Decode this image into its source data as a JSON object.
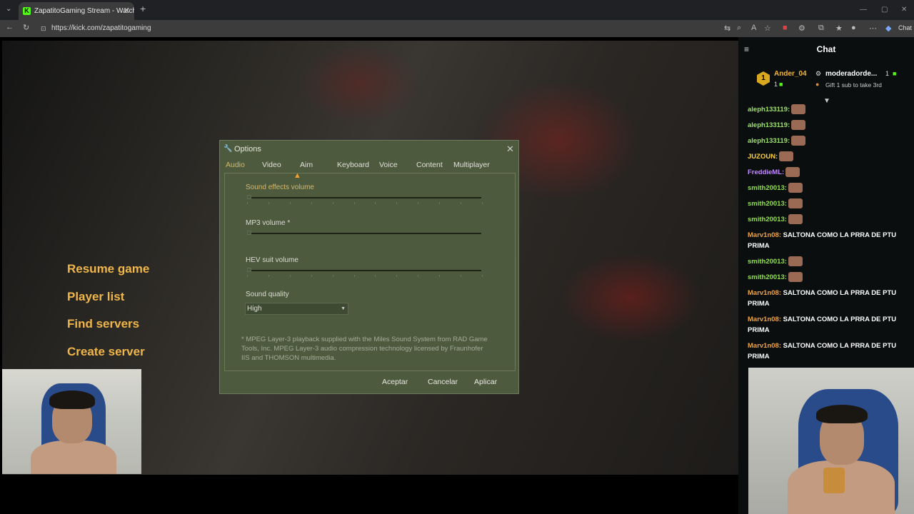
{
  "browser": {
    "tab_title": "ZapatitoGaming Stream - Watch L",
    "favicon_letter": "K",
    "url": "https://kick.com/zapatitogaming",
    "chat_button": "Chat"
  },
  "game_menu": {
    "items": [
      "Resume game",
      "Player list",
      "Find servers",
      "Create server"
    ]
  },
  "dialog": {
    "title": "Options",
    "tabs": [
      "Audio",
      "Video",
      "Aim",
      "Keyboard",
      "Voice",
      "Content",
      "Multiplayer"
    ],
    "active_tab": "Audio",
    "sliders": [
      {
        "label": "Sound effects volume",
        "value": 0
      },
      {
        "label": "MP3 volume *",
        "value": 0
      },
      {
        "label": "HEV suit volume",
        "value": 0
      }
    ],
    "sound_quality_label": "Sound quality",
    "sound_quality_value": "High",
    "note": "* MPEG Layer-3 playback supplied with the Miles Sound System from RAD Game Tools, Inc. MPEG Layer-3 audio compression technology licensed by Fraunhofer IIS and THOMSON multimedia.",
    "buttons": {
      "ok": "Aceptar",
      "cancel": "Cancelar",
      "apply": "Aplicar"
    }
  },
  "chat": {
    "title": "Chat",
    "gifters": [
      {
        "rank": "1",
        "name": "Ander_04",
        "count": "1"
      },
      {
        "name": "moderadorde...",
        "count": "1",
        "sub": "Gift 1 sub to take 3rd"
      }
    ],
    "messages": [
      {
        "user": "aleph133119:",
        "text": "",
        "color": "#9ee06b"
      },
      {
        "user": "aleph133119:",
        "text": "",
        "color": "#9ee06b"
      },
      {
        "user": "aleph133119:",
        "text": "",
        "color": "#9ee06b"
      },
      {
        "user": "JUZOUN:",
        "text": "",
        "color": "#ffd23f"
      },
      {
        "user": "FreddieML:",
        "text": "",
        "color": "#c38cff"
      },
      {
        "user": "smith20013:",
        "text": "",
        "color": "#8fdf4e"
      },
      {
        "user": "smith20013:",
        "text": "",
        "color": "#8fdf4e"
      },
      {
        "user": "smith20013:",
        "text": "",
        "color": "#8fdf4e"
      },
      {
        "user": "Marv1n08:",
        "text": "SALTONA COMO LA PRRA DE PTU PRIMA",
        "color": "#f3a23c"
      },
      {
        "user": "smith20013:",
        "text": "",
        "color": "#8fdf4e"
      },
      {
        "user": "smith20013:",
        "text": "",
        "color": "#8fdf4e"
      },
      {
        "user": "Marv1n08:",
        "text": "SALTONA COMO LA PRRA DE PTU PRIMA",
        "color": "#f3a23c"
      },
      {
        "user": "Marv1n08:",
        "text": "SALTONA COMO LA PRRA DE PTU PRIMA",
        "color": "#f3a23c"
      },
      {
        "user": "Marv1n08:",
        "text": "SALTONA COMO LA PRRA DE PTU PRIMA",
        "color": "#f3a23c"
      }
    ]
  }
}
